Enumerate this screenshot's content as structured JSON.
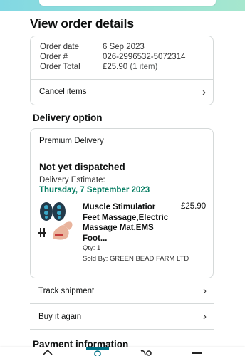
{
  "page": {
    "title": "View order details"
  },
  "order_summary": {
    "rows": [
      {
        "label": "Order date",
        "value": "6 Sep 2023",
        "extra": ""
      },
      {
        "label": "Order #",
        "value": "026-2996532-5072314",
        "extra": ""
      },
      {
        "label": "Order Total",
        "value": "£25.90",
        "extra": "(1 item)"
      }
    ],
    "cancel_label": "Cancel items"
  },
  "delivery": {
    "section_title": "Delivery option",
    "option": "Premium Delivery",
    "status": "Not yet dispatched",
    "estimate_label": "Delivery Estimate:",
    "estimate_date": "Thursday, 7 September 2023",
    "product": {
      "title": "Muscle Stimulatior Feet Massage,Electric Massage Mat,EMS Foot...",
      "price": "£25.90",
      "qty": "Qty: 1",
      "seller": "Sold By: GREEN BEAD FARM LTD"
    }
  },
  "actions": {
    "track_label": "Track shipment",
    "buy_again_label": "Buy it again"
  },
  "payment": {
    "section_title": "Payment information"
  },
  "colors": {
    "accent_teal": "#007185",
    "delivery_green": "#067d62",
    "header_gradient_start": "#82d8e3",
    "header_gradient_end": "#a6e7ce"
  },
  "icons": [
    "chevron-right-icon",
    "product-thumbnail-icon",
    "home-icon",
    "profile-icon",
    "cart-icon",
    "menu-icon"
  ]
}
